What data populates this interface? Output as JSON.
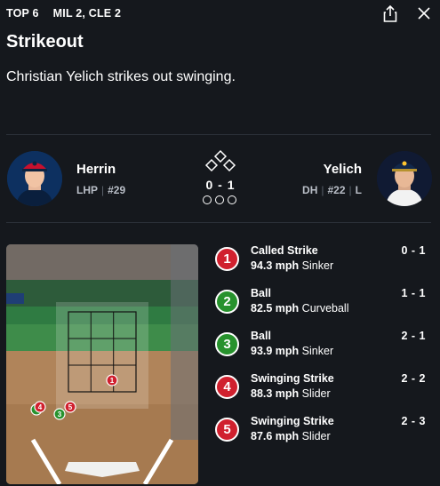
{
  "header": {
    "inning": "TOP 6",
    "score": "MIL 2, CLE 2"
  },
  "play": {
    "title": "Strikeout",
    "description": "Christian Yelich strikes out swinging."
  },
  "matchup": {
    "pitcher": {
      "name": "Herrin",
      "position": "LHP",
      "number": "#29"
    },
    "batter": {
      "name": "Yelich",
      "position": "DH",
      "number": "#22",
      "bats": "L"
    },
    "count": "0 - 1"
  },
  "pitches": [
    {
      "n": "1",
      "result": "Called Strike",
      "speed": "94.3 mph",
      "type": "Sinker",
      "count": "0 - 1",
      "color": "#d0202e"
    },
    {
      "n": "2",
      "result": "Ball",
      "speed": "82.5 mph",
      "type": "Curveball",
      "count": "1 - 1",
      "color": "#27922d"
    },
    {
      "n": "3",
      "result": "Ball",
      "speed": "93.9 mph",
      "type": "Sinker",
      "count": "2 - 1",
      "color": "#27922d"
    },
    {
      "n": "4",
      "result": "Swinging Strike",
      "speed": "88.3 mph",
      "type": "Slider",
      "count": "2 - 2",
      "color": "#d0202e"
    },
    {
      "n": "5",
      "result": "Swinging Strike",
      "speed": "87.6 mph",
      "type": "Slider",
      "count": "2 - 3",
      "color": "#d0202e"
    }
  ],
  "icons": {
    "share": "share-icon",
    "close": "close-icon"
  }
}
